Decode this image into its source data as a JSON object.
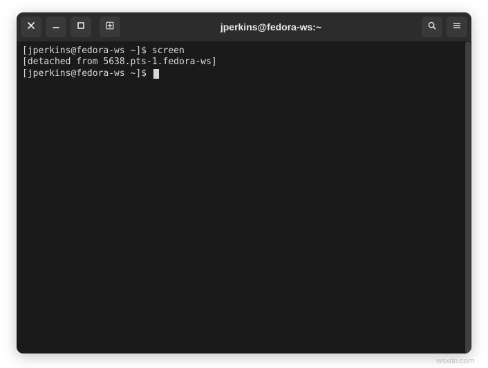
{
  "titlebar": {
    "title": "jperkins@fedora-ws:~",
    "buttons": {
      "close": "close-icon",
      "minimize": "minimize-icon",
      "maximize": "maximize-icon",
      "newtab": "new-tab-icon",
      "search": "search-icon",
      "menu": "hamburger-icon"
    }
  },
  "terminal": {
    "lines": [
      "[jperkins@fedora-ws ~]$ screen",
      "[detached from 5638.pts-1.fedora-ws]",
      "[jperkins@fedora-ws ~]$ "
    ]
  },
  "watermark": "wsxdn.com"
}
